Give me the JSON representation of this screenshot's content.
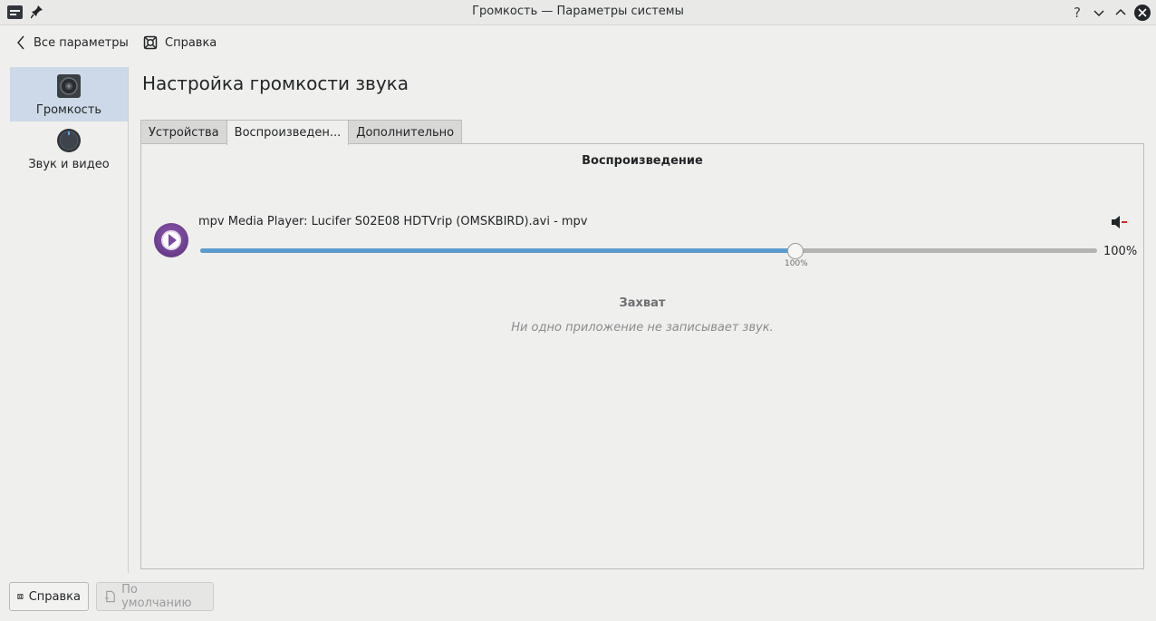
{
  "window": {
    "title": "Громкость — Параметры системы",
    "help_glyph": "?"
  },
  "toolbar": {
    "back_label": "Все параметры",
    "help_label": "Справка"
  },
  "sidebar": {
    "items": [
      {
        "label": "Громкость",
        "icon": "speaker-icon",
        "active": true
      },
      {
        "label": "Звук и видео",
        "icon": "knob-icon",
        "active": false
      }
    ]
  },
  "main": {
    "title": "Настройка громкости звука",
    "tabs": [
      {
        "label": "Устройства",
        "active": false
      },
      {
        "label": "Воспроизведен...",
        "active": true
      },
      {
        "label": "Дополнительно",
        "active": false
      }
    ],
    "playback": {
      "heading": "Воспроизведение",
      "streams": [
        {
          "name": "mpv Media Player: Lucifer S02E08 HDTVrip (OMSKBIRD).avi - mpv",
          "icon": "mpv-icon",
          "volume_fraction": 0.664,
          "volume_label": "100%",
          "mark_label": "100%"
        }
      ]
    },
    "capture": {
      "heading": "Захват",
      "empty_text": "Ни одно приложение не записывает звук."
    }
  },
  "footer": {
    "help_label": "Справка",
    "defaults_label": "По умолчанию"
  },
  "colors": {
    "accent": "#5c9bd0",
    "sidebar_active": "#cdd9e8",
    "mute_accent": "#d22b2b"
  }
}
